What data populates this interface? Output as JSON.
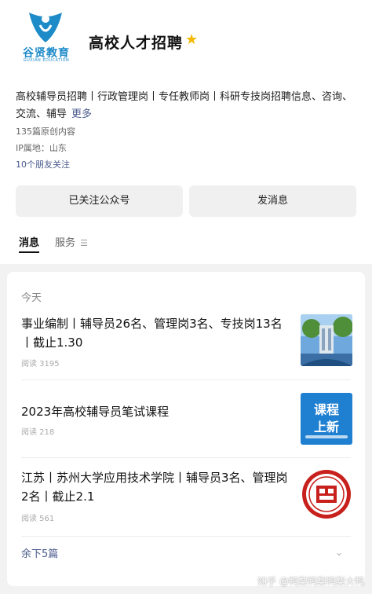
{
  "header": {
    "logo_text": "谷贤教育",
    "logo_sub": "GUXIAN EDUCATION",
    "account_name": "高校人才招聘",
    "star_icon": "star-icon"
  },
  "profile": {
    "description": "高校辅导员招聘丨行政管理岗丨专任教师岗丨科研专技岗招聘信息、咨询、交流、辅导",
    "more": "更多",
    "original_count": "135篇原创内容",
    "ip_location": "IP属地：山东",
    "friends_follow": "10个朋友关注"
  },
  "actions": {
    "followed": "已关注公众号",
    "message": "发消息"
  },
  "tabs": {
    "messages": "消息",
    "services": "服务",
    "services_icon": "menu-icon"
  },
  "list": {
    "day_label": "今天",
    "items": [
      {
        "title": "事业编制丨辅导员26名、管理岗3名、专技岗13名丨截止1.30",
        "reads": "阅读 3195",
        "thumb": "campus-photo"
      },
      {
        "title": "2023年高校辅导员笔试课程",
        "reads": "阅读 218",
        "thumb": "course-update",
        "thumb_text_1": "课程",
        "thumb_text_2": "上新"
      },
      {
        "title": "江苏丨苏州大学应用技术学院丨辅导员3名、管理岗2名丨截止2.1",
        "reads": "阅读 561",
        "thumb": "university-seal"
      }
    ],
    "remaining": "余下5篇"
  },
  "watermark": "知乎 @鸭梨鸭梨鸭梨大鸭",
  "colors": {
    "brand_blue": "#1e8bc9",
    "link": "#4a5b8c",
    "star": "#f5b800",
    "seal_red": "#c8201c"
  }
}
